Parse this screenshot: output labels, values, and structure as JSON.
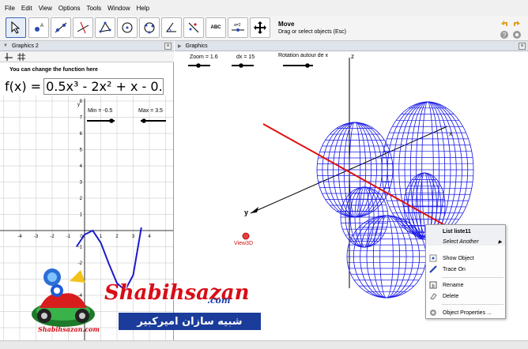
{
  "menu": [
    "File",
    "Edit",
    "View",
    "Options",
    "Tools",
    "Window",
    "Help"
  ],
  "toolbar": {
    "tool_text": "ABC",
    "slider_text": "a=2",
    "info_title": "Move",
    "info_subtitle": "Drag or select objects (Esc)"
  },
  "left_panel": {
    "title": "Graphics 2",
    "hint": "You can change the function here",
    "fx_label": "f(x) =",
    "fx_value": "0.5x³ - 2x² + x - 0.25",
    "min_label": "Min = -0.5",
    "max_label": "Max = 3.5",
    "x_ticks": [
      "-4",
      "-3",
      "-2",
      "-1",
      "0",
      "1",
      "2",
      "3",
      "4"
    ],
    "y_ticks": [
      "8",
      "7",
      "6",
      "5",
      "4",
      "3",
      "2",
      "1",
      "-1",
      "-2",
      "-3",
      "-4",
      "-5"
    ],
    "y_axis_label": "y"
  },
  "right_panel": {
    "title": "Graphics",
    "zoom_label": "Zoom = 1.6",
    "dx_label": "dx = 15",
    "rotation_label": "Rotation autour de x",
    "axis_y_label": "y",
    "axis_x_label": "x",
    "axis_z_label": "z",
    "point_label": "View3D"
  },
  "context_menu": {
    "title": "List liste11",
    "select_another": "Select Another",
    "show_object": "Show Object",
    "trace_on": "Trace On",
    "rename": "Rename",
    "delete": "Delete",
    "object_properties": "Object Properties ..."
  },
  "watermark": {
    "brand": "Shabihsazan",
    "dotcom": ".com",
    "persian": "شبیه سازان امیرکبیر",
    "small": "Shabihsazan.com"
  },
  "colors": {
    "mesh": "#1515e8",
    "red_line": "#e01010",
    "curve": "#1a1acc",
    "brand_red": "#d80d17",
    "brand_blue": "#1b3c9a"
  },
  "chart_data": {
    "type": "line",
    "title": "",
    "series": [
      {
        "x": [
          -0.5,
          0,
          0.5,
          1,
          1.5,
          2,
          2.5,
          3,
          3.5
        ],
        "y": [
          -1.0,
          -0.25,
          0.0,
          -0.75,
          -2.06,
          -3.25,
          -3.69,
          -2.75,
          0.19
        ]
      }
    ],
    "xlim": [
      -4.5,
      4.5
    ],
    "ylim": [
      -5.5,
      8.5
    ],
    "grid": true
  }
}
